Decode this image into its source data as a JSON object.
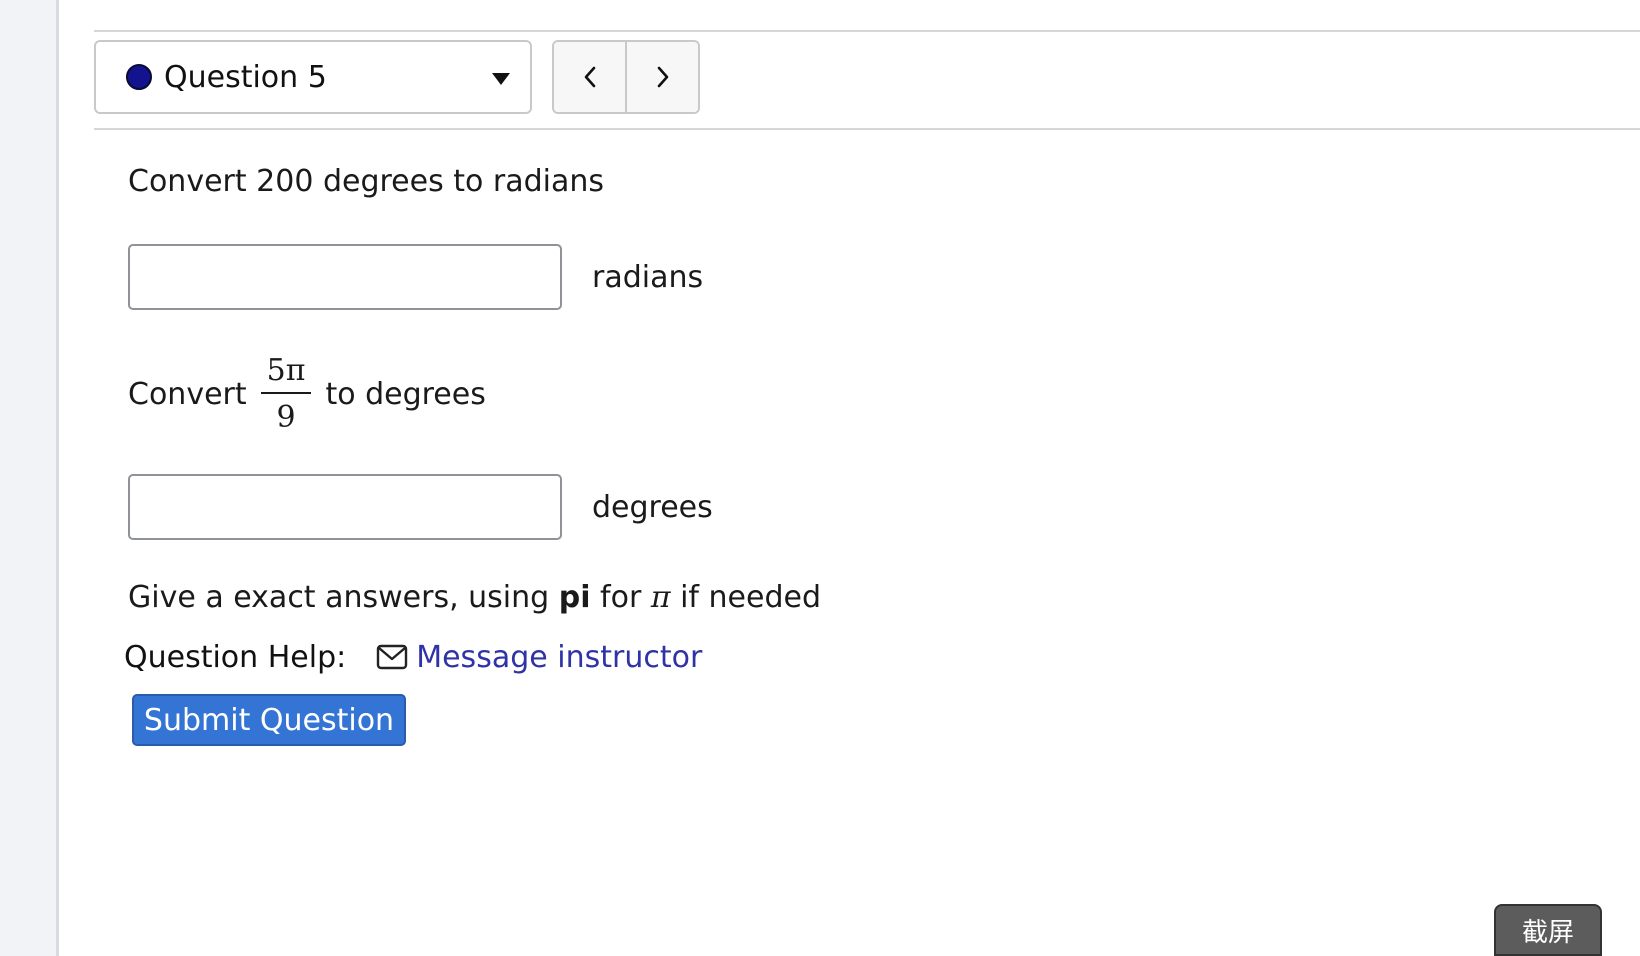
{
  "question_nav": {
    "selected_question": "Question 5",
    "status_color": "#13138f",
    "prev_icon": "chevron-left-icon",
    "next_icon": "chevron-right-icon"
  },
  "problem": {
    "part1_prompt": "Convert 200 degrees to radians",
    "part1_answer_value": "",
    "part1_unit": "radians",
    "part2_prefix": "Convert",
    "part2_fraction_numerator": "5π",
    "part2_fraction_denominator": "9",
    "part2_suffix": "to degrees",
    "part2_answer_value": "",
    "part2_unit": "degrees",
    "instruction_prefix": "Give a exact answers, using ",
    "instruction_bold": "pi",
    "instruction_middle": " for ",
    "instruction_symbol": "π",
    "instruction_suffix": " if needed"
  },
  "help": {
    "label": "Question Help:",
    "icon": "mail-icon",
    "message_link": "Message instructor"
  },
  "actions": {
    "submit_label": "Submit Question",
    "submit_color": "#3474d4"
  },
  "overlay": {
    "screenshot_button": "截屏"
  }
}
